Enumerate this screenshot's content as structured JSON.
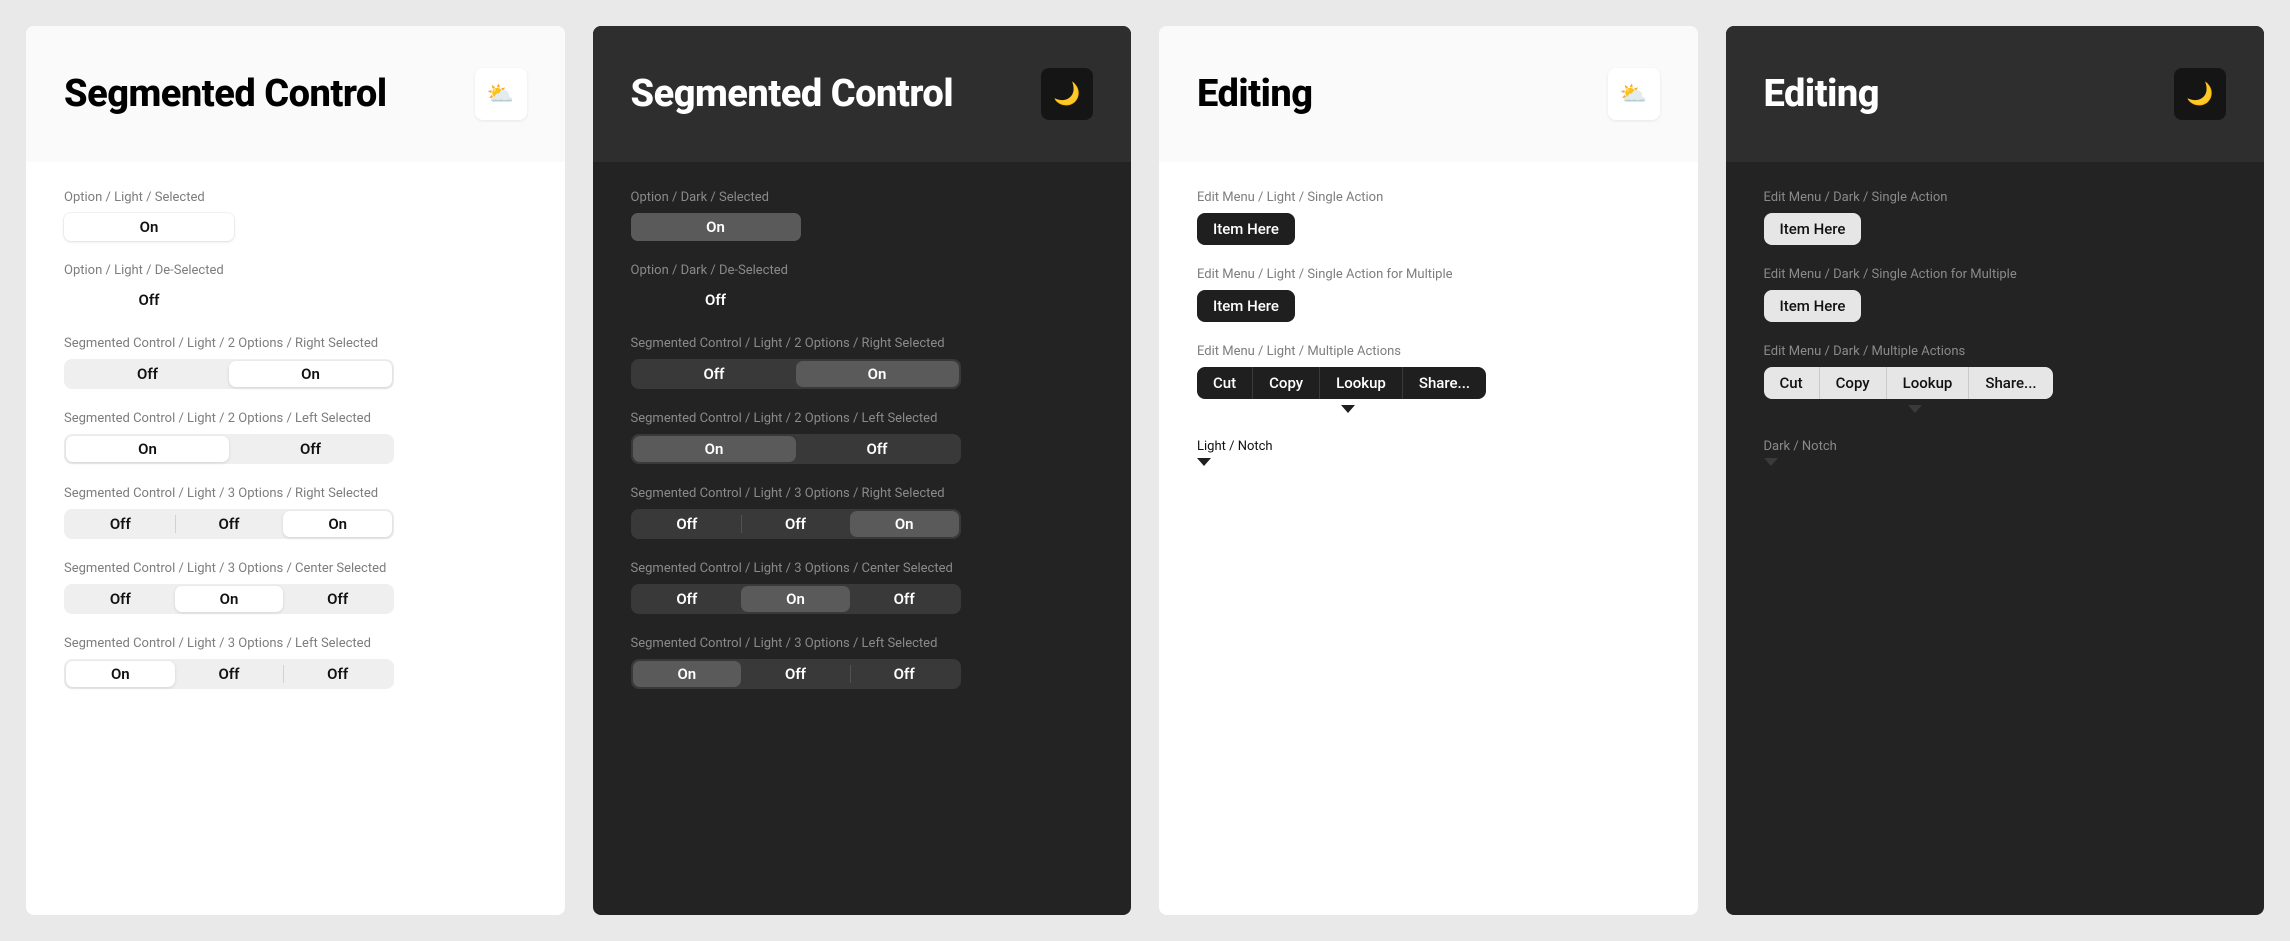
{
  "segLight": {
    "title": "Segmented Control",
    "badge": "⛅",
    "sections": {
      "opt_sel": {
        "label": "Option / Light / Selected",
        "text": "On"
      },
      "opt_desel": {
        "label": "Option / Light / De-Selected",
        "text": "Off"
      },
      "two_right": {
        "label": "Segmented Control / Light / 2 Options / Right Selected",
        "opts": [
          "Off",
          "On"
        ],
        "sel": 1
      },
      "two_left": {
        "label": "Segmented Control / Light / 2 Options / Left Selected",
        "opts": [
          "On",
          "Off"
        ],
        "sel": 0
      },
      "three_right": {
        "label": "Segmented Control / Light / 3 Options / Right Selected",
        "opts": [
          "Off",
          "Off",
          "On"
        ],
        "sel": 2
      },
      "three_center": {
        "label": "Segmented Control / Light / 3 Options / Center Selected",
        "opts": [
          "Off",
          "On",
          "Off"
        ],
        "sel": 1
      },
      "three_left": {
        "label": "Segmented Control / Light / 3 Options / Left Selected",
        "opts": [
          "On",
          "Off",
          "Off"
        ],
        "sel": 0
      }
    }
  },
  "segDark": {
    "title": "Segmented Control",
    "badge": "🌙",
    "sections": {
      "opt_sel": {
        "label": "Option / Dark / Selected",
        "text": "On"
      },
      "opt_desel": {
        "label": "Option / Dark / De-Selected",
        "text": "Off"
      },
      "two_right": {
        "label": "Segmented Control / Light / 2 Options / Right Selected",
        "opts": [
          "Off",
          "On"
        ],
        "sel": 1
      },
      "two_left": {
        "label": "Segmented Control / Light / 2 Options / Left Selected",
        "opts": [
          "On",
          "Off"
        ],
        "sel": 0
      },
      "three_right": {
        "label": "Segmented Control / Light / 3 Options / Right Selected",
        "opts": [
          "Off",
          "Off",
          "On"
        ],
        "sel": 2
      },
      "three_center": {
        "label": "Segmented Control / Light / 3 Options / Center Selected",
        "opts": [
          "Off",
          "On",
          "Off"
        ],
        "sel": 1
      },
      "three_left": {
        "label": "Segmented Control / Light / 3 Options / Left Selected",
        "opts": [
          "On",
          "Off",
          "Off"
        ],
        "sel": 0
      }
    }
  },
  "editLight": {
    "title": "Editing",
    "badge": "⛅",
    "single": {
      "label": "Edit Menu / Light / Single Action",
      "items": [
        "Item Here"
      ]
    },
    "single_multi": {
      "label": "Edit Menu / Light / Single Action for Multiple",
      "items": [
        "Item Here"
      ]
    },
    "multi": {
      "label": "Edit Menu / Light / Multiple Actions",
      "items": [
        "Cut",
        "Copy",
        "Lookup",
        "Share..."
      ]
    },
    "notch": {
      "label": "Light / Notch"
    }
  },
  "editDark": {
    "title": "Editing",
    "badge": "🌙",
    "single": {
      "label": "Edit Menu / Dark / Single Action",
      "items": [
        "Item Here"
      ]
    },
    "single_multi": {
      "label": "Edit Menu / Dark / Single Action for Multiple",
      "items": [
        "Item Here"
      ]
    },
    "multi": {
      "label": "Edit Menu / Dark / Multiple Actions",
      "items": [
        "Cut",
        "Copy",
        "Lookup",
        "Share..."
      ]
    },
    "notch": {
      "label": "Dark / Notch"
    }
  },
  "colors": {
    "notch_light": "#1f1f1f",
    "notch_dark": "#3a3a3a"
  }
}
